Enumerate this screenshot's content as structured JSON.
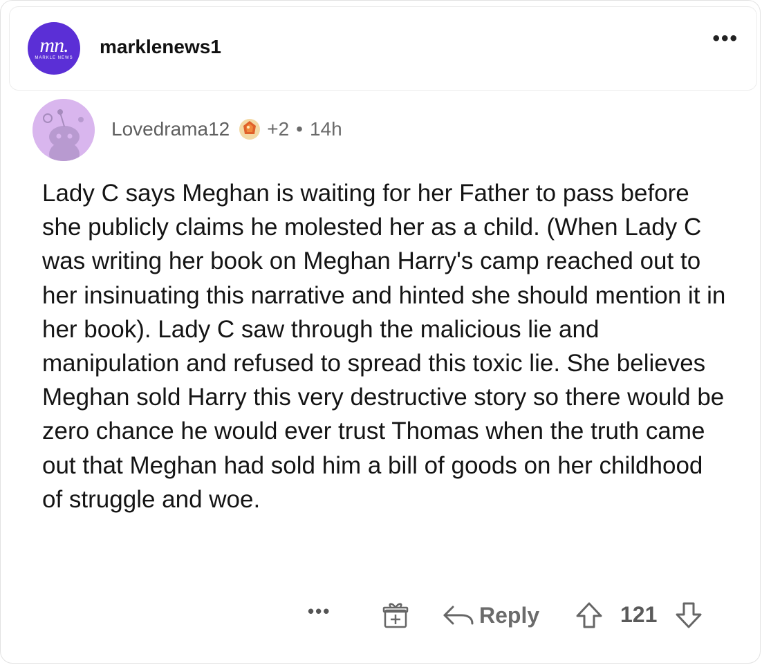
{
  "post": {
    "page_name": "marklenews1",
    "avatar_monogram": "mn.",
    "avatar_subtext": "MARKLE NEWS",
    "more_label": "•••"
  },
  "comment": {
    "author": "Lovedrama12",
    "award_count": "+2",
    "separator": "•",
    "age": "14h",
    "body": "Lady C says Meghan is waiting for her Father to pass before she publicly claims he molested her as a child. (When Lady C was writing her book on Meghan Harry's camp reached out to her insinuating this narrative and hinted she should mention it in her book). Lady C saw through the malicious lie and manipulation and refused to spread this toxic lie. She believes Meghan sold Harry this very destructive story so there would be zero chance he would ever trust Thomas when the truth came out that Meghan had sold him a bill of goods on her childhood of struggle and woe."
  },
  "actions": {
    "more_label": "•••",
    "reply_label": "Reply",
    "score": "121"
  },
  "colors": {
    "page_avatar_bg": "#5b2fd6",
    "comment_avatar_bg": "#d9b6ee",
    "muted_text": "#6b6b6b"
  },
  "icons": [
    "gift-icon",
    "reply-arrow-icon",
    "upvote-arrow-icon",
    "downvote-arrow-icon",
    "award-icon",
    "snoo-avatar-icon"
  ]
}
